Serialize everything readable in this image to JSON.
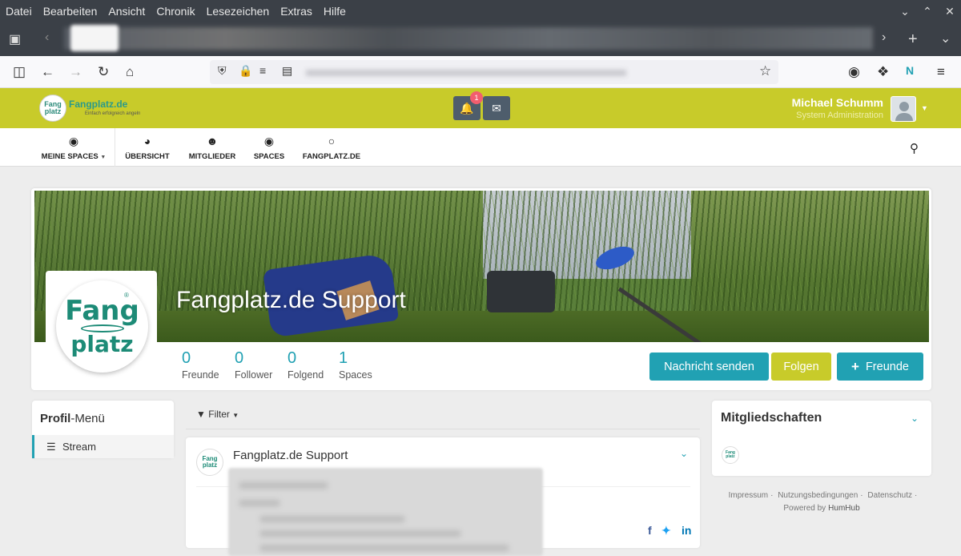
{
  "menubar": {
    "items": [
      "Datei",
      "Bearbeiten",
      "Ansicht",
      "Chronik",
      "Lesezeichen",
      "Extras",
      "Hilfe"
    ]
  },
  "site": {
    "logo_name": "Fangplatz.de",
    "logo_tagline": "Einfach erfolgreich angeln",
    "logo_small": "Fang platz",
    "notification_count": "1",
    "user_name": "Michael Schumm",
    "user_role": "System Administration"
  },
  "topmenu": {
    "items": [
      {
        "label": "MEINE SPACES",
        "icon": "dot-circle-icon"
      },
      {
        "label": "ÜBERSICHT",
        "icon": "dashboard-icon"
      },
      {
        "label": "MITGLIEDER",
        "icon": "users-icon"
      },
      {
        "label": "SPACES",
        "icon": "dot-circle-icon"
      },
      {
        "label": "FANGPLATZ.DE",
        "icon": "circle-icon"
      }
    ]
  },
  "profile": {
    "title": "Fangplatz.de Support",
    "logo_line1": "Fang",
    "logo_line2": "platz",
    "stats": [
      {
        "value": "0",
        "label": "Freunde"
      },
      {
        "value": "0",
        "label": "Follower"
      },
      {
        "value": "0",
        "label": "Folgend"
      },
      {
        "value": "1",
        "label": "Spaces"
      }
    ],
    "buttons": {
      "message": "Nachricht senden",
      "follow": "Folgen",
      "friends": "Freunde"
    }
  },
  "left": {
    "title_bold": "Profil",
    "title_rest": "-Menü",
    "item": "Stream"
  },
  "stream": {
    "filter": "Filter",
    "post_author": "Fangplatz.de Support"
  },
  "right": {
    "title": "Mitgliedschaften",
    "footer_links": [
      "Impressum",
      "Nutzungsbedingungen",
      "Datenschutz"
    ],
    "powered_prefix": "Powered by",
    "powered_name": "HumHub"
  },
  "colors": {
    "brand_green": "#c8cb2a",
    "teal": "#21a1b3",
    "header_button": "#4e5d6c",
    "badge": "#f25e6e"
  }
}
